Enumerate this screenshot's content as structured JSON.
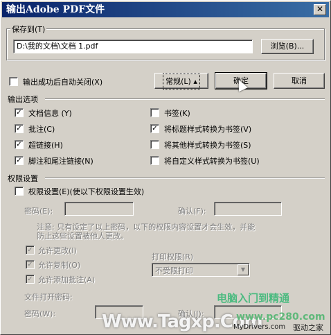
{
  "window": {
    "title": "输出Adobe PDF文件",
    "close_glyph": "✕"
  },
  "save_to": {
    "group_label": "保存到(T)",
    "path_value": "D:\\我的文档\\文档 1.pdf",
    "browse_label": "浏览(B)..."
  },
  "auto_close": {
    "label": "输出成功后自动关闭(X)",
    "checked": false
  },
  "buttons": {
    "general_label": "常规(L) ▴",
    "ok_label": "确定",
    "cancel_label": "取消"
  },
  "output_options": {
    "header": "输出选项",
    "left": [
      {
        "label": "文档信息 (Y)",
        "checked": true
      },
      {
        "label": "批注(C)",
        "checked": true
      },
      {
        "label": "超链接(H)",
        "checked": true
      },
      {
        "label": "脚注和尾注链接(N)",
        "checked": true
      }
    ],
    "right": [
      {
        "label": "书签(K)",
        "checked": false
      },
      {
        "label": "将标题样式转换为书签(V)",
        "checked": true
      },
      {
        "label": "将其他样式转换为书签(S)",
        "checked": false
      },
      {
        "label": "将自定义样式转换为书签(U)",
        "checked": false
      }
    ]
  },
  "permissions": {
    "header": "权限设置",
    "enable_label": "权限设置(E)(使以下权限设置生效)",
    "enable_checked": false,
    "password_label": "密码(E):",
    "confirm_label": "确认(F):",
    "note_line1": "注意: 只有设定了以上密码，以下的权限内容设置才会生效，并能",
    "note_line2": "防止这些设置被他人更改。",
    "allow_change": "允许更改(I)",
    "allow_copy": "允许复制(O)",
    "allow_annotate": "允许添加批注(A)",
    "print_label": "打印权限(R)",
    "print_value": "不受限打印",
    "open_password_label": "文件打开密码:",
    "open_pw_label": "密码(W):",
    "open_confirm_label": "确认(J):"
  },
  "watermarks": {
    "green_cn": "电脑入门到精通",
    "tagxp": "Www.Tagxp.Com",
    "pc280": "www.pc280.com",
    "mydrivers": "MyDrivers.com",
    "driver_home": "驱动之家"
  }
}
